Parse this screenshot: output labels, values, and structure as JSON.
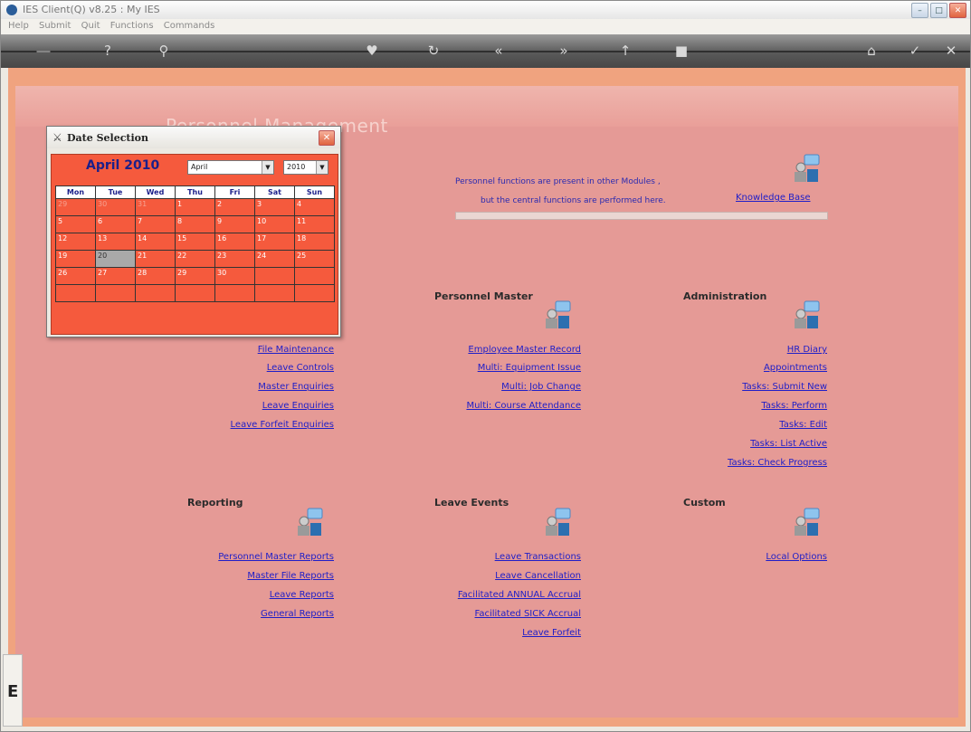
{
  "window": {
    "title": "IES Client(Q) v8.25 : My IES"
  },
  "menu": [
    "Help",
    "Submit",
    "Quit",
    "Functions",
    "Commands"
  ],
  "toolbar": {
    "icons": [
      "key-icon",
      "help-icon",
      "search-icon",
      "heart-icon",
      "refresh-icon",
      "back-icon",
      "forward-icon",
      "up-icon",
      "stop-icon",
      "home-icon",
      "ok-icon",
      "close-icon"
    ]
  },
  "page": {
    "title": "Personnel Management"
  },
  "note": {
    "line1": "Personnel functions are present in other Modules ,",
    "line2": "but the central functions are performed here.",
    "kb_link": "Knowledge Base"
  },
  "sections": {
    "left_top": {
      "links": [
        "File Maintenance",
        "Leave Controls",
        "Master Enquiries",
        "Leave Enquiries",
        "Leave Forfeit Enquiries"
      ]
    },
    "personnel_master": {
      "title": "Personnel Master",
      "links": [
        "Employee Master Record",
        "Multi: Equipment Issue",
        "Multi: Job Change",
        "Multi: Course Attendance"
      ]
    },
    "administration": {
      "title": "Administration",
      "links": [
        "HR Diary",
        "Appointments",
        "Tasks: Submit New",
        "Tasks: Perform",
        "Tasks: Edit",
        "Tasks: List Active",
        "Tasks: Check Progress"
      ]
    },
    "reporting": {
      "title": "Reporting",
      "links": [
        "Personnel Master Reports",
        "Master File Reports",
        "Leave Reports",
        "General Reports"
      ]
    },
    "leave_events": {
      "title": "Leave Events",
      "links": [
        "Leave Transactions",
        "Leave Cancellation",
        "Facilitated ANNUAL Accrual",
        "Facilitated SICK Accrual",
        "Leave Forfeit"
      ]
    },
    "custom": {
      "title": "Custom",
      "links": [
        "Local Options"
      ]
    }
  },
  "date_popup": {
    "title": "Date Selection",
    "month_label": "April 2010",
    "month_select": "April",
    "year_select": "2010",
    "days": [
      "Mon",
      "Tue",
      "Wed",
      "Thu",
      "Fri",
      "Sat",
      "Sun"
    ],
    "weeks": [
      [
        "29",
        "30",
        "31",
        "1",
        "2",
        "3",
        "4"
      ],
      [
        "5",
        "6",
        "7",
        "8",
        "9",
        "10",
        "11"
      ],
      [
        "12",
        "13",
        "14",
        "15",
        "16",
        "17",
        "18"
      ],
      [
        "19",
        "20",
        "21",
        "22",
        "23",
        "24",
        "25"
      ],
      [
        "26",
        "27",
        "28",
        "29",
        "30",
        "",
        ""
      ],
      [
        "",
        "",
        "",
        "",
        "",
        "",
        ""
      ]
    ],
    "today": "20"
  },
  "bottom_fragment": {
    "label": "E"
  }
}
